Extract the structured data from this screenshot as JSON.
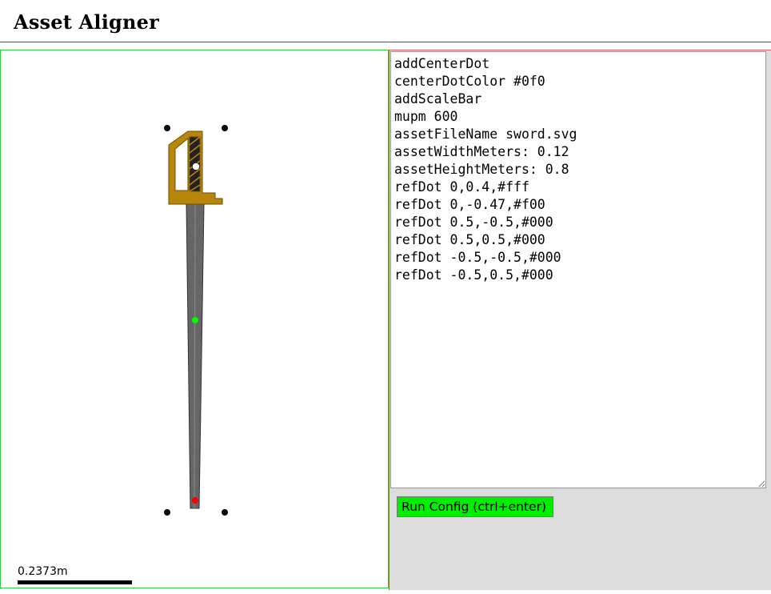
{
  "app": {
    "title": "Asset Aligner"
  },
  "canvas": {
    "scale_label": "0.2373m",
    "center_dot_color": "#0f0",
    "asset_name": "sword",
    "ref_dots": [
      {
        "color": "#fff"
      },
      {
        "color": "#f00"
      },
      {
        "color": "#000"
      },
      {
        "color": "#000"
      },
      {
        "color": "#000"
      },
      {
        "color": "#000"
      }
    ]
  },
  "config": {
    "text": "addCenterDot\ncenterDotColor #0f0\naddScaleBar\nmupm 600\nassetFileName sword.svg\nassetWidthMeters: 0.12\nassetHeightMeters: 0.8\nrefDot 0,0.4,#fff\nrefDot 0,-0.47,#f00\nrefDot 0.5,-0.5,#000\nrefDot 0.5,0.5,#000\nrefDot -0.5,-0.5,#000\nrefDot -0.5,0.5,#000",
    "run_label": "Run Config (ctrl+enter)"
  },
  "colors": {
    "run_button": "#00ee00",
    "canvas_border": "#2ecc40",
    "config_bg": "#dcdcdc",
    "hilt": "#b8860b",
    "blade": "#666666"
  }
}
